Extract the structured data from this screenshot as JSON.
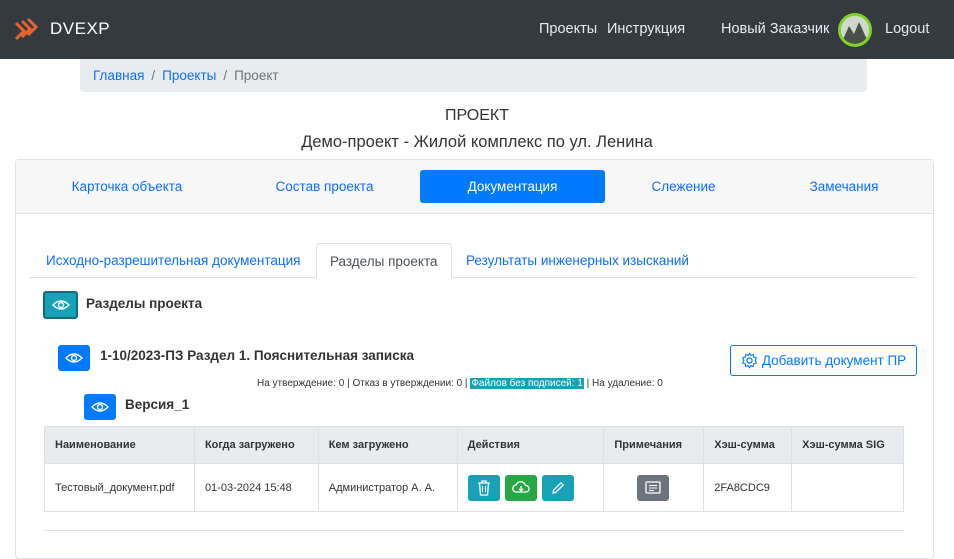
{
  "brand": {
    "name": "DVEXP",
    "accent": "#e8622c"
  },
  "nav": {
    "projects": "Проекты",
    "instructions": "Инструкция",
    "user": "Новый Заказчик",
    "logout": "Logout"
  },
  "breadcrumb": {
    "home": "Главная",
    "projects": "Проекты",
    "current": "Проект"
  },
  "page": {
    "heading": "ПРОЕКТ",
    "subtitle": "Демо-проект - Жилой комплекс по ул. Ленина"
  },
  "main_tabs": [
    {
      "label": "Карточка объекта"
    },
    {
      "label": "Состав проекта"
    },
    {
      "label": "Документация",
      "active": true
    },
    {
      "label": "Слежение"
    },
    {
      "label": "Замечания"
    }
  ],
  "sub_tabs": [
    {
      "label": "Исходно-разрешительная документация"
    },
    {
      "label": "Разделы проекта",
      "active": true
    },
    {
      "label": "Результаты инженерных изысканий"
    }
  ],
  "sections": {
    "title": "Разделы проекта",
    "section_title": "1-10/2023-ПЗ Раздел 1. Пояснительная записка",
    "add_button": "Добавить документ ПР",
    "status_before": "На утверждение: 0 | Отказ в утверждении: 0 |",
    "status_highlight": "Файлов без подписей: 1",
    "status_after": "| На удаление: 0",
    "version": "Версия_1"
  },
  "table": {
    "headers": [
      "Наименование",
      "Когда загружено",
      "Кем загружено",
      "Действия",
      "Примечания",
      "Хэш-сумма",
      "Хэш-сумма SIG"
    ],
    "rows": [
      {
        "name": "Тестовый_документ.pdf",
        "uploaded": "01-03-2024 15:48",
        "by": "Администратор А. А.",
        "hash": "2FA8CDC9",
        "hash_sig": ""
      }
    ]
  }
}
